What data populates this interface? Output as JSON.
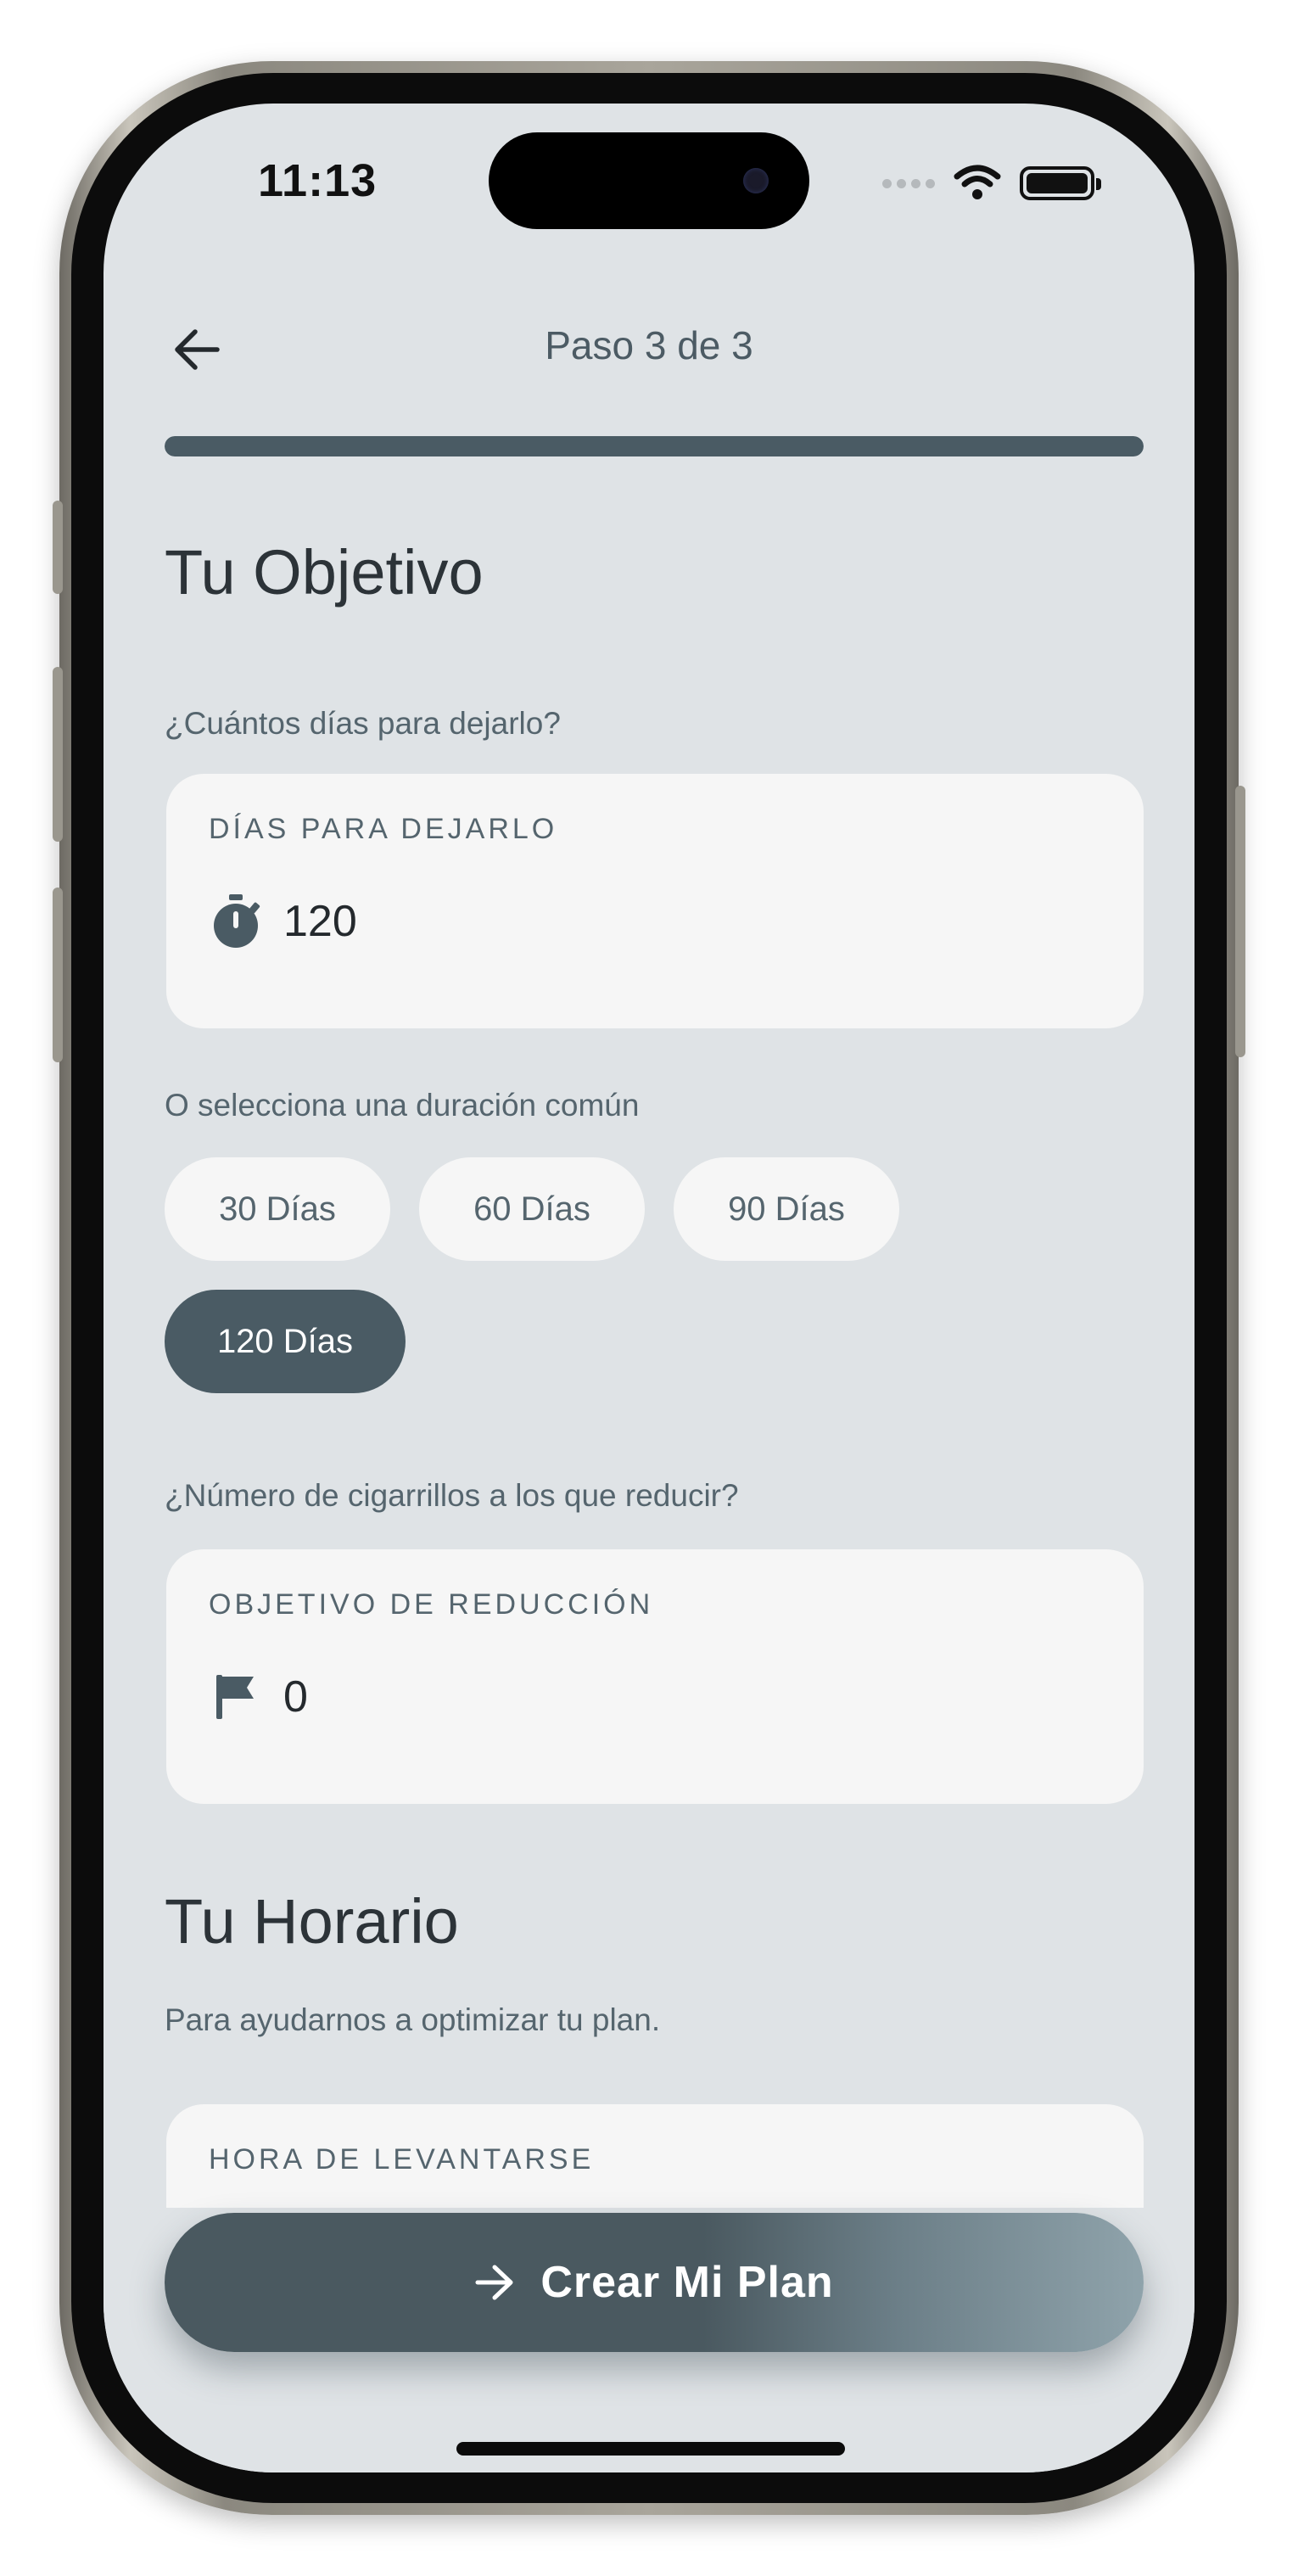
{
  "status_bar": {
    "time": "11:13"
  },
  "header": {
    "step_text": "Paso 3 de 3",
    "progress_fraction": 1.0
  },
  "goal": {
    "title": "Tu Objetivo",
    "days_question": "¿Cuántos días para dejarlo?",
    "days_card": {
      "label": "DÍAS PARA DEJARLO",
      "value": "120",
      "icon": "stopwatch-icon"
    },
    "durations_label": "O selecciona una duración común",
    "durations": [
      {
        "label": "30 Días",
        "selected": false
      },
      {
        "label": "60 Días",
        "selected": false
      },
      {
        "label": "90 Días",
        "selected": false
      },
      {
        "label": "120 Días",
        "selected": true
      }
    ],
    "reduction_question": "¿Número de cigarrillos a los que reducir?",
    "reduction_card": {
      "label": "OBJETIVO DE REDUCCIÓN",
      "value": "0",
      "icon": "flag-icon"
    }
  },
  "schedule": {
    "title": "Tu Horario",
    "subtitle": "Para ayudarnos a optimizar tu plan.",
    "wake_card": {
      "label": "HORA DE LEVANTARSE"
    }
  },
  "cta": {
    "label": "Crear Mi Plan",
    "icon": "arrow-right-icon"
  },
  "colors": {
    "accent": "#4a5b64",
    "background": "#dfe3e6",
    "card": "#f6f6f6"
  }
}
